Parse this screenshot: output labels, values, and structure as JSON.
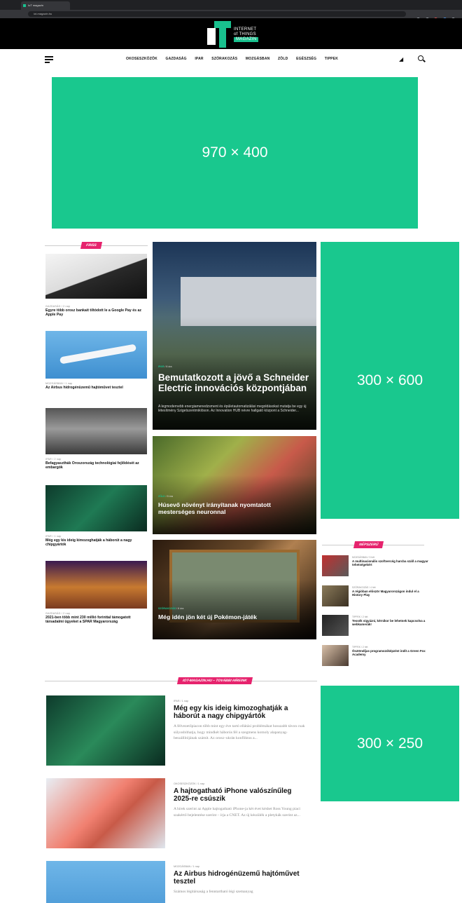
{
  "browser": {
    "tab_title": "IoT magazin",
    "url": "iot-magazin.hu"
  },
  "logo": {
    "line1": "INTERNET",
    "line2": "of THINGS",
    "line3": "MAGAZIN"
  },
  "nav": {
    "items": [
      "OKOSESZKÖZÖK",
      "GAZDASÁG",
      "IPAR",
      "SZÓRAKOZÁS",
      "MOZGÁSBAN",
      "ZÖLD",
      "EGÉSZSÉG",
      "TIPPEK"
    ],
    "rss_glyph": "◢"
  },
  "ads": {
    "top": "970 × 400",
    "side": "300 × 600",
    "side2": "300 × 250"
  },
  "sections": {
    "friss": "FRISS",
    "nepszeru": "NÉPSZERŰ",
    "more": "IOT-MAGAZIN.HU – TOVÁBBI HÍREINK"
  },
  "friss": [
    {
      "meta": "GAZDASÁG / 2 nap",
      "title": "Egyre több orosz bankait tiltódott le a Google Pay és az Apple Pay"
    },
    {
      "meta": "MOZGÁSBAN / 1 nap",
      "title": "Az Airbus hidrogénüzemű hajtóművet tesztel"
    },
    {
      "meta": "IPAR / 2 nap",
      "title": "Befagyaszthák Oroszország technológiai fejlődését az embargók"
    },
    {
      "meta": "IPAR / 1 nap",
      "title": "Még egy kis ideig kimozoghatják a háborút a nagy chipgyártók"
    },
    {
      "meta": "GAZDASÁG / 2 nap",
      "title": "2021-ben több mint 230 millió forinttal támogatott társadalmi ügyeket a SPAR Magyarország"
    }
  ],
  "features": [
    {
      "meta_cat": "IPAR",
      "meta_time": "/ 6 óra",
      "title": "Bemutatkozott a jövő a Schneider Electric innovációs központjában",
      "excerpt": "A legmodernebb energiamenedzsment és épületautomatizálási megoldásokat mutatja be egy új létesítmény Szigetszentmiklóson. Az Innovation HUB névre hallgató központ a Schneider..."
    },
    {
      "meta_cat": "ZÖLD",
      "meta_time": "/ 5 óra",
      "title": "Húsevő növényt irányítanak nyomtatott mesterséges neuronnal"
    },
    {
      "meta_cat": "SZÓRAKOZÁS",
      "meta_time": "/ 6 óra",
      "title": "Még idén jön két új Pokémon-játék"
    }
  ],
  "popular": [
    {
      "meta": "MOZGÁSBAN / 3 hét",
      "title": "A multinacionális szoftvercég harcba száll a magyar tehetségekért"
    },
    {
      "meta": "SZÓRAKOZÁS / 4 hét",
      "title": "A régióban először Magyarországon indul el a History Play"
    },
    {
      "meta": "TIPPEK / 2 hét",
      "title": "Tessék vigyázni, kérnikor be lehetnek kapcsolva a webkamerák!"
    },
    {
      "meta": "TIPPEK / 2 hét",
      "title": "Ösztöndíjas programozóképzést indít a Green Fox Academy"
    }
  ],
  "more": [
    {
      "meta": "IPAR / 1 nap",
      "title": "Még egy kis ideig kimozoghatják a háborút a nagy chipgyártók",
      "excerpt": "A félvezetőpiacon több mint egy éve tartó ellátási problémákat hosszabb távon csak súlyosbíthatja, hogy mindkét háborús fél a szegmens komoly alapanyag-beszállítójának számít. Az orosz–ukrán konfliktus a..."
    },
    {
      "meta": "OKOSESZKÖZÖK / 1 nap",
      "title": "A hajtogatható iPhone valószínűleg 2025-re csúszik",
      "excerpt": "A hírek szerint az Apple hajtogatható iPhone-ja két évet késhet Ross Young piaci szakértő bejelentése szerint – írja a CNET. Az új készülék a pletykák szerint az..."
    },
    {
      "meta": "MOZGÁSBAN / 1 nap",
      "title": "Az Airbus hidrogénüzemű hajtóművet tesztel",
      "excerpt": "Számos légitársaság a fenntartható légi szemanyag"
    }
  ]
}
